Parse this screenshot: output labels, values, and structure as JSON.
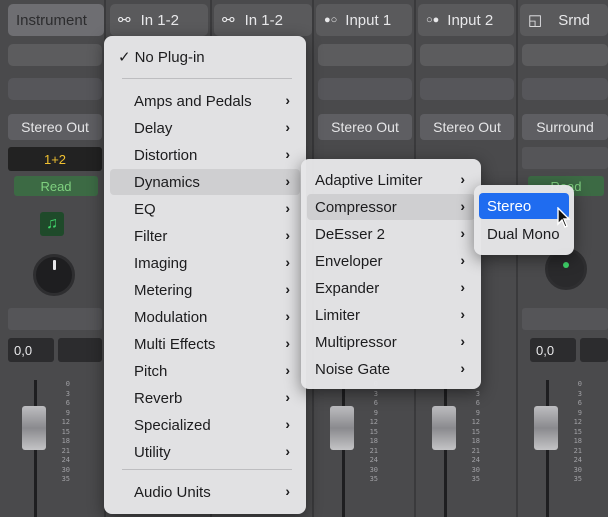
{
  "headers": [
    {
      "label": "Instrument"
    },
    {
      "icon": "link-icon",
      "label": "In 1-2"
    },
    {
      "icon": "link-icon",
      "label": "In 1-2"
    },
    {
      "icon": "input-icon",
      "label": "Input 1"
    },
    {
      "icon": "input-icon",
      "label": "Input 2"
    },
    {
      "icon": "surround-icon",
      "label": "Srnd"
    }
  ],
  "strips": {
    "outputs": [
      "Stereo Out",
      "Stereo Out",
      "Stereo Out",
      "Surround"
    ],
    "group": "1+2",
    "automation": "Read",
    "value": "0,0",
    "value2": "0,0",
    "scale": [
      "0",
      "3",
      "6",
      "9",
      "12",
      "15",
      "18",
      "21",
      "24",
      "",
      "30",
      "35"
    ]
  },
  "menu": {
    "no_plugin": "No Plug-in",
    "checkmark": "✓",
    "items": [
      "Amps and Pedals",
      "Delay",
      "Distortion",
      "Dynamics",
      "EQ",
      "Filter",
      "Imaging",
      "Metering",
      "Modulation",
      "Multi Effects",
      "Pitch",
      "Reverb",
      "Specialized",
      "Utility"
    ],
    "audio_units": "Audio Units",
    "chevron": "›"
  },
  "dynamics_submenu": {
    "items": [
      "Adaptive Limiter",
      "Compressor",
      "DeEsser 2",
      "Enveloper",
      "Expander",
      "Limiter",
      "Multipressor",
      "Noise Gate"
    ]
  },
  "compressor_submenu": {
    "items": [
      "Stereo",
      "Dual Mono"
    ]
  }
}
